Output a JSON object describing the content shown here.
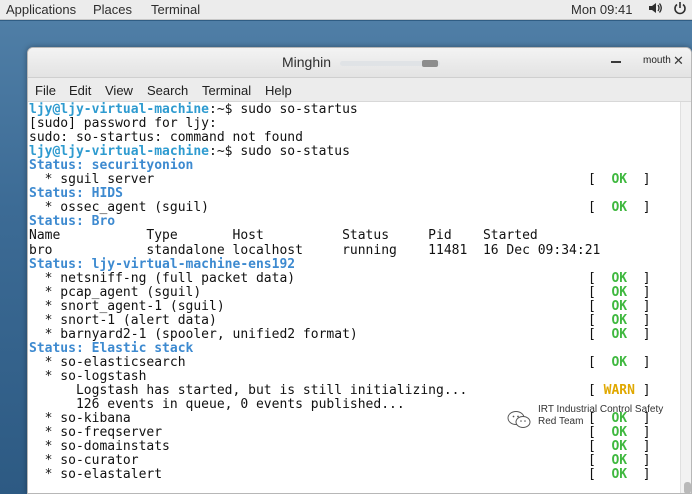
{
  "topbar": {
    "applications": "Applications",
    "places": "Places",
    "terminal": "Terminal",
    "clock": "Mon 09:41"
  },
  "window": {
    "title": "Minghin",
    "label": "mouth",
    "menu": [
      "File",
      "Edit",
      "View",
      "Search",
      "Terminal",
      "Help"
    ]
  },
  "terminal": {
    "lines": [
      {
        "type": "prompt",
        "prompt": "ljy@ljy-virtual-machine",
        "path": ":~$ ",
        "cmd": "sudo so-startus"
      },
      {
        "type": "text",
        "text": "[sudo] password for ljy:"
      },
      {
        "type": "text",
        "text": "sudo: so-startus: command not found"
      },
      {
        "type": "prompt",
        "prompt": "ljy@ljy-virtual-machine",
        "path": ":~$ ",
        "cmd": "sudo so-status"
      },
      {
        "type": "header",
        "text": "Status: securityonion"
      },
      {
        "type": "text",
        "text": "  * sguil server",
        "status": "OK"
      },
      {
        "type": "header",
        "text": "Status: HIDS"
      },
      {
        "type": "text",
        "text": "  * ossec_agent (sguil)",
        "status": "OK"
      },
      {
        "type": "header",
        "text": "Status: Bro"
      },
      {
        "type": "text",
        "text": "Name           Type       Host          Status     Pid    Started"
      },
      {
        "type": "text",
        "text": "bro            standalone localhost     running    11481  16 Dec 09:34:21"
      },
      {
        "type": "header",
        "text": "Status: ljy-virtual-machine-ens192"
      },
      {
        "type": "text",
        "text": "  * netsniff-ng (full packet data)",
        "status": "OK"
      },
      {
        "type": "text",
        "text": "  * pcap_agent (sguil)",
        "status": "OK"
      },
      {
        "type": "text",
        "text": "  * snort_agent-1 (sguil)",
        "status": "OK"
      },
      {
        "type": "text",
        "text": "  * snort-1 (alert data)",
        "status": "OK"
      },
      {
        "type": "text",
        "text": "  * barnyard2-1 (spooler, unified2 format)",
        "status": "OK"
      },
      {
        "type": "header",
        "text": "Status: Elastic stack"
      },
      {
        "type": "text",
        "text": "  * so-elasticsearch",
        "status": "OK"
      },
      {
        "type": "text",
        "text": "  * so-logstash"
      },
      {
        "type": "text",
        "text": "      Logstash has started, but is still initializing...",
        "status": "WARN"
      },
      {
        "type": "text",
        "text": "      126 events in queue, 0 events published..."
      },
      {
        "type": "text",
        "text": "  * so-kibana",
        "status": "OK"
      },
      {
        "type": "text",
        "text": "  * so-freqserver",
        "status": "OK"
      },
      {
        "type": "text",
        "text": "  * so-domainstats",
        "status": "OK"
      },
      {
        "type": "text",
        "text": "  * so-curator",
        "status": "OK"
      },
      {
        "type": "text",
        "text": "  * so-elastalert",
        "status": "OK"
      }
    ]
  },
  "watermark": {
    "line1": "IRT Industrial Control Safety",
    "line2": "Red Team"
  },
  "icons": [
    "volume-icon",
    "power-icon",
    "close-icon",
    "minimize-icon",
    "wechat-icon"
  ],
  "colors": {
    "prompt": "#2e9bd0",
    "header": "#3d8ad0",
    "ok": "#3fb83f",
    "warn": "#e0a800"
  }
}
